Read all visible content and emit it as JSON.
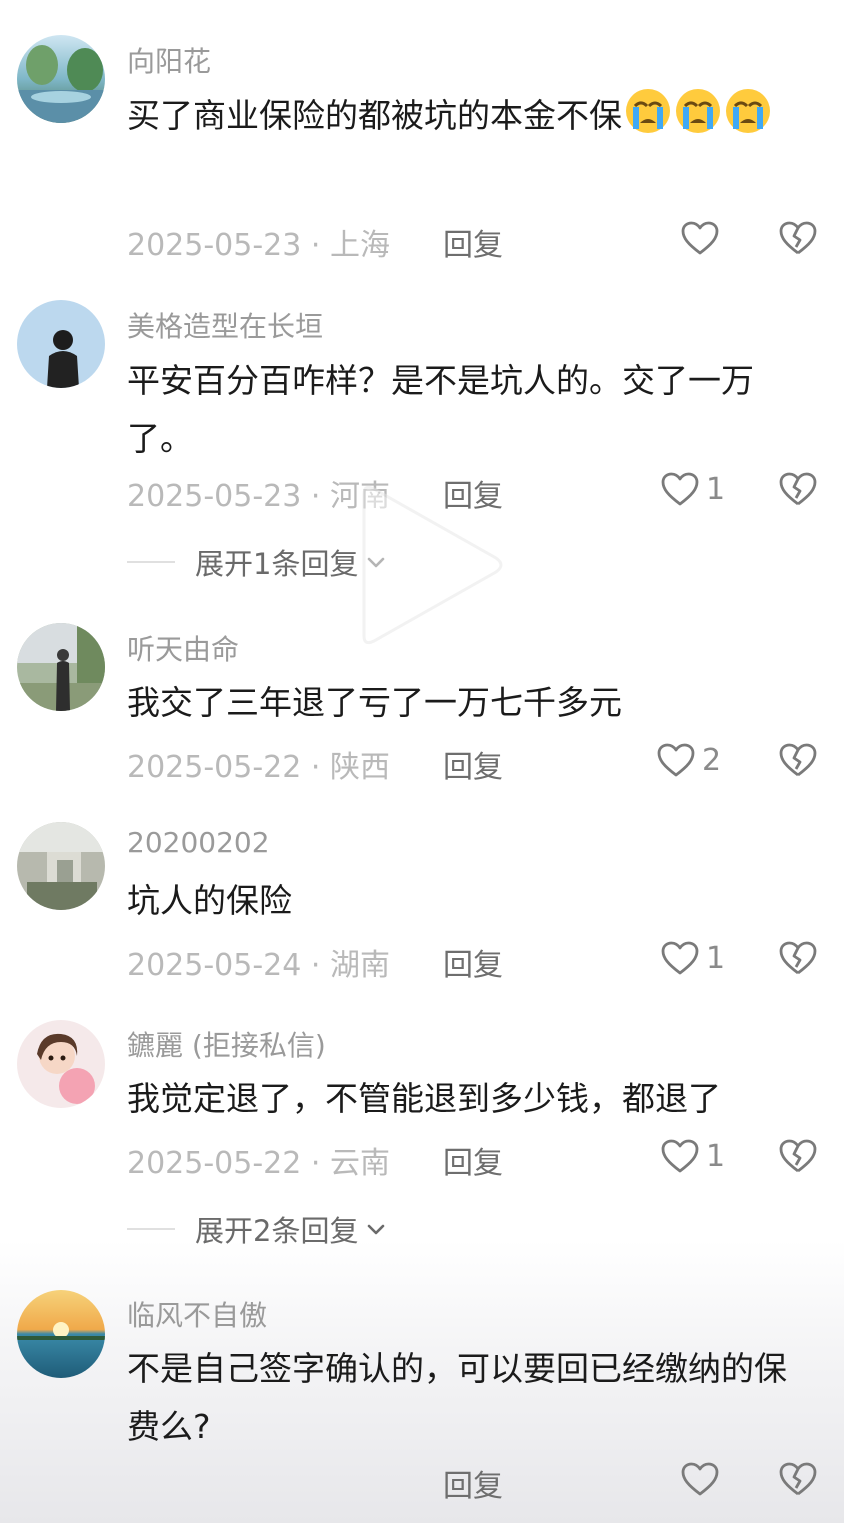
{
  "comments": [
    {
      "username": "向阳花",
      "text": "买了商业保险的都被坑的本金不保",
      "emoji": "loudly-crying-face",
      "date": "2025-05-23",
      "location": "上海",
      "reply_label": "回复",
      "likes": ""
    },
    {
      "username": "美格造型在长垣",
      "text": "平安百分百咋样？是不是坑人的。交了一万了。",
      "date": "2025-05-23",
      "location": "河南",
      "reply_label": "回复",
      "likes": "1",
      "expand_label": "展开1条回复"
    },
    {
      "username": "听天由命",
      "text": "我交了三年退了亏了一万七千多元",
      "date": "2025-05-22",
      "location": "陕西",
      "reply_label": "回复",
      "likes": "2"
    },
    {
      "username": "20200202",
      "text": "坑人的保险",
      "date": "2025-05-24",
      "location": "湖南",
      "reply_label": "回复",
      "likes": "1"
    },
    {
      "username": "鑣麗 (拒接私信)",
      "text": "我觉定退了，不管能退到多少钱，都退了",
      "date": "2025-05-22",
      "location": "云南",
      "reply_label": "回复",
      "likes": "1",
      "expand_label": "展开2条回复"
    },
    {
      "username": "临风不自傲",
      "text": "不是自己签字确认的，可以要回已经缴纳的保费么?",
      "reply_label": "回复",
      "likes": ""
    }
  ],
  "meta_separator": " · ",
  "icons": {
    "like": "heart-outline-icon",
    "dislike": "broken-heart-icon",
    "expand": "chevron-down-icon",
    "overlay": "play-icon"
  },
  "colors": {
    "username": "#9a9a9a",
    "text": "#1b1b1b",
    "meta": "#b9b9b9",
    "icon": "#7a7a7a"
  }
}
